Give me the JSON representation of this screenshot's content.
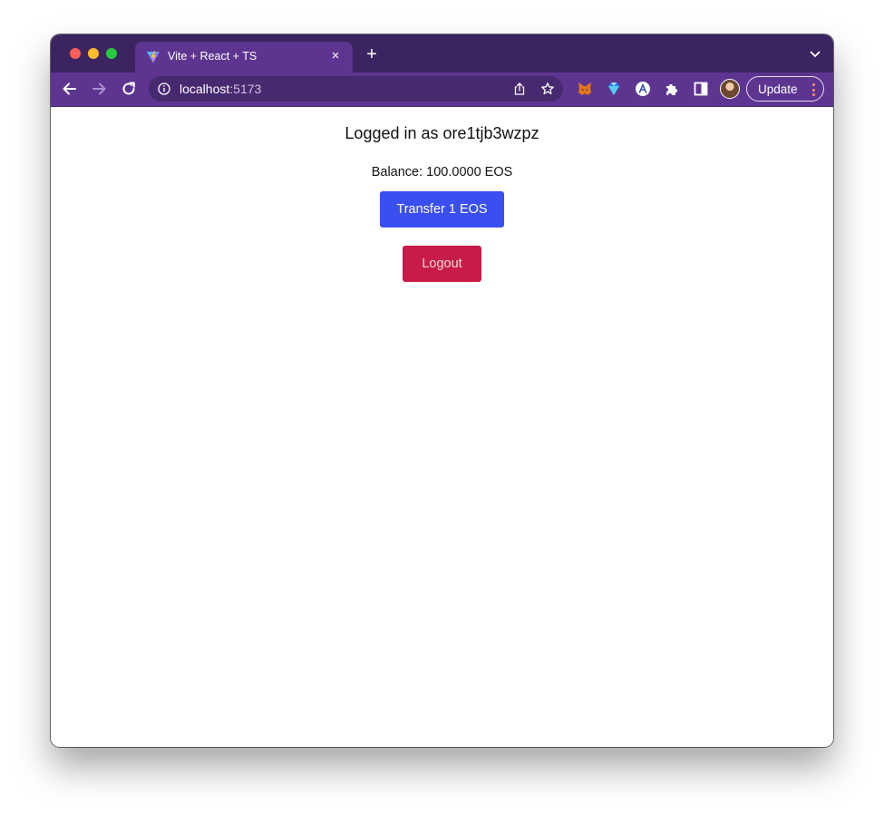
{
  "browser": {
    "tab": {
      "title": "Vite + React + TS",
      "close_glyph": "×",
      "favicon": "vite-logo-icon"
    },
    "new_tab_glyph": "+",
    "omnibox": {
      "host": "localhost",
      "port": ":5173"
    },
    "update_label": "Update",
    "extensions": [
      "metamask-fox-icon",
      "diamond-wallet-icon",
      "anchor-wallet-icon",
      "puzzle-extensions-icon",
      "side-panel-icon"
    ],
    "colors": {
      "tabstrip": "#3c2461",
      "toolbar": "#5d3591"
    }
  },
  "page": {
    "logged_in_text": "Logged in as ore1tjb3wzpz",
    "balance_text": "Balance: 100.0000 EOS",
    "transfer_label": "Transfer 1 EOS",
    "logout_label": "Logout",
    "colors": {
      "transfer_button": "#3a4ff0",
      "logout_button": "#c81b48"
    }
  }
}
